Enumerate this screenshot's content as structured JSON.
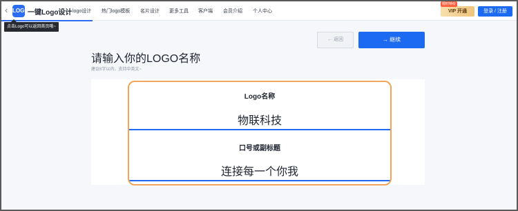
{
  "header": {
    "logo_text": "LOGO",
    "brand": "一键Logo设计",
    "nav": [
      "logo设计",
      "热门logo模板",
      "名片设计",
      "更多工具",
      "客户端",
      "会员介绍",
      "个人中心"
    ],
    "vip_tag": "限时特价",
    "vip_label": "VIP 开通",
    "login_label": "登录 / 注册"
  },
  "tooltip": "点击Logo可以返回首页哦~",
  "actions": {
    "back_label": "← 返回",
    "next_label": "→   继续"
  },
  "page": {
    "title": "请输入你的LOGO名称",
    "hint": "建议6字以内，支持中英文~"
  },
  "form": {
    "name_label": "Logo名称",
    "name_value": "物联科技",
    "slogan_label": "口号或副标题",
    "slogan_value": "连接每一个你我"
  },
  "colors": {
    "accent": "#1d6af2",
    "highlight_border": "#f0a55a"
  }
}
